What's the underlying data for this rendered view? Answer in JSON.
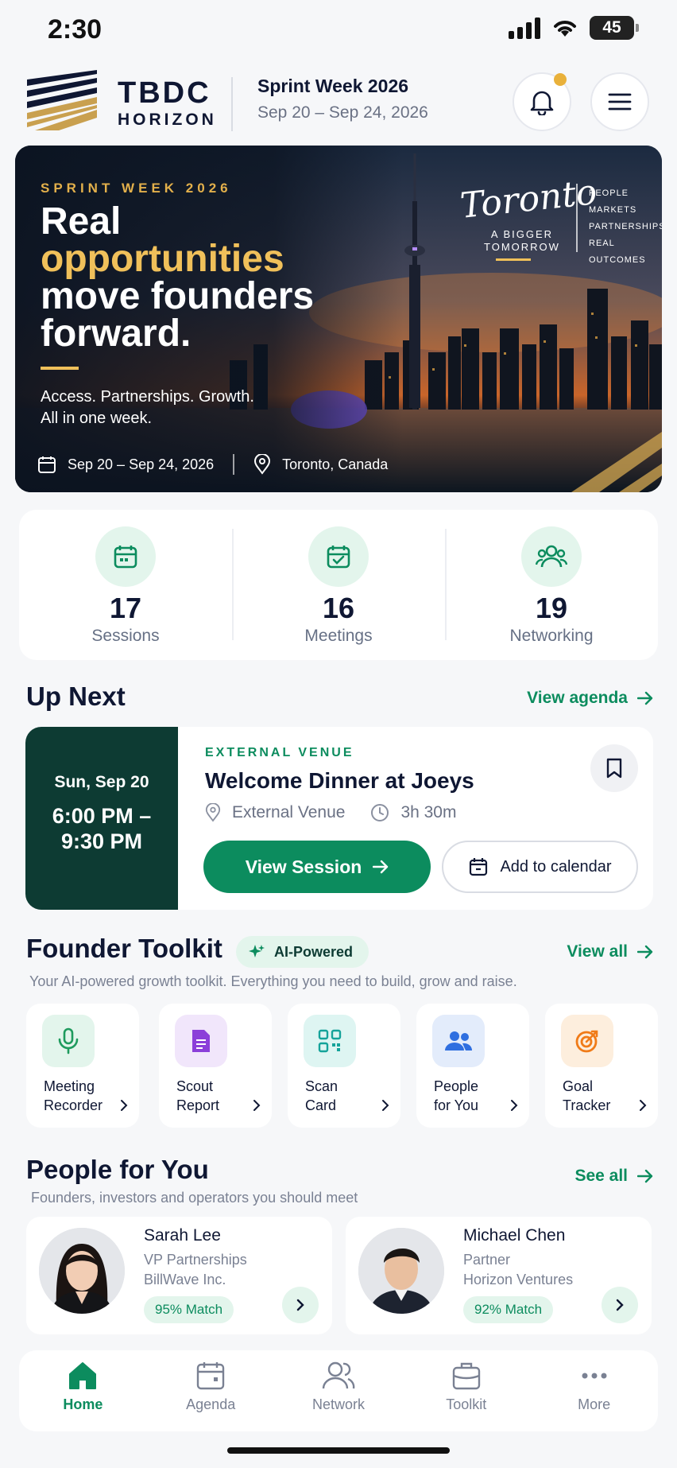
{
  "status": {
    "time": "2:30",
    "battery": "45"
  },
  "header": {
    "brand_line1": "TBDC",
    "brand_line2": "HORIZON",
    "event_name": "Sprint Week 2026",
    "event_dates": "Sep 20 – Sep 24, 2026"
  },
  "hero": {
    "kicker": "SPRINT WEEK 2026",
    "title_line1": "Real",
    "title_line2": "opportunities",
    "title_line3": "move founders",
    "title_line4": "forward.",
    "sub_line1": "Access. Partnerships. Growth.",
    "sub_line2": "All in one week.",
    "dates": "Sep 20 – Sep 24, 2026",
    "location": "Toronto, Canada",
    "city_script": "Toronto",
    "city_tag_line1": "A BIGGER",
    "city_tag_line2": "TOMORROW",
    "pillars": [
      "PEOPLE",
      "MARKETS",
      "PARTNERSHIPS",
      "REAL OUTCOMES"
    ]
  },
  "stats": [
    {
      "value": "17",
      "label": "Sessions",
      "icon": "calendar-icon"
    },
    {
      "value": "16",
      "label": "Meetings",
      "icon": "calendar-check-icon"
    },
    {
      "value": "19",
      "label": "Networking",
      "icon": "people-icon"
    }
  ],
  "up_next": {
    "title": "Up Next",
    "link": "View agenda",
    "day": "Sun, Sep 20",
    "time_line1": "6:00 PM –",
    "time_line2": "9:30 PM",
    "venue_tag": "EXTERNAL VENUE",
    "session_title": "Welcome Dinner at Joeys",
    "venue": "External Venue",
    "duration": "3h 30m",
    "primary_button": "View Session",
    "secondary_button": "Add to calendar"
  },
  "toolkit": {
    "title": "Founder Toolkit",
    "badge": "AI-Powered",
    "link": "View all",
    "subtitle": "Your AI-powered growth toolkit. Everything you need to build, grow and raise.",
    "items": [
      {
        "line1": "Meeting",
        "line2": "Recorder",
        "icon": "microphone-icon",
        "color": "#1f9b5e",
        "bg": "#e3f5ec"
      },
      {
        "line1": "Scout",
        "line2": "Report",
        "icon": "document-icon",
        "color": "#8b3fd9",
        "bg": "#f1e6fb"
      },
      {
        "line1": "Scan",
        "line2": "Card",
        "icon": "qr-code-icon",
        "color": "#15a39a",
        "bg": "#def5f2"
      },
      {
        "line1": "People",
        "line2": "for You",
        "icon": "people-icon",
        "color": "#2f6fe0",
        "bg": "#e3ecfb"
      },
      {
        "line1": "Goal",
        "line2": "Tracker",
        "icon": "target-icon",
        "color": "#f07b18",
        "bg": "#fdeedd"
      }
    ]
  },
  "people": {
    "title": "People for You",
    "link": "See all",
    "subtitle": "Founders, investors and operators you should meet",
    "items": [
      {
        "name": "Sarah Lee",
        "role": "VP Partnerships",
        "company": "BillWave Inc.",
        "match": "95% Match"
      },
      {
        "name": "Michael Chen",
        "role": "Partner",
        "company": "Horizon Ventures",
        "match": "92% Match"
      }
    ]
  },
  "tabs": [
    {
      "label": "Home",
      "icon": "home-icon",
      "active": true
    },
    {
      "label": "Agenda",
      "icon": "calendar-icon"
    },
    {
      "label": "Network",
      "icon": "people-icon"
    },
    {
      "label": "Toolkit",
      "icon": "briefcase-icon"
    },
    {
      "label": "More",
      "icon": "more-dots-icon"
    }
  ],
  "colors": {
    "accent": "#0c8c5e",
    "gold": "#f0c05a",
    "navy": "#0f1733",
    "dark_teal": "#0d3b33"
  }
}
